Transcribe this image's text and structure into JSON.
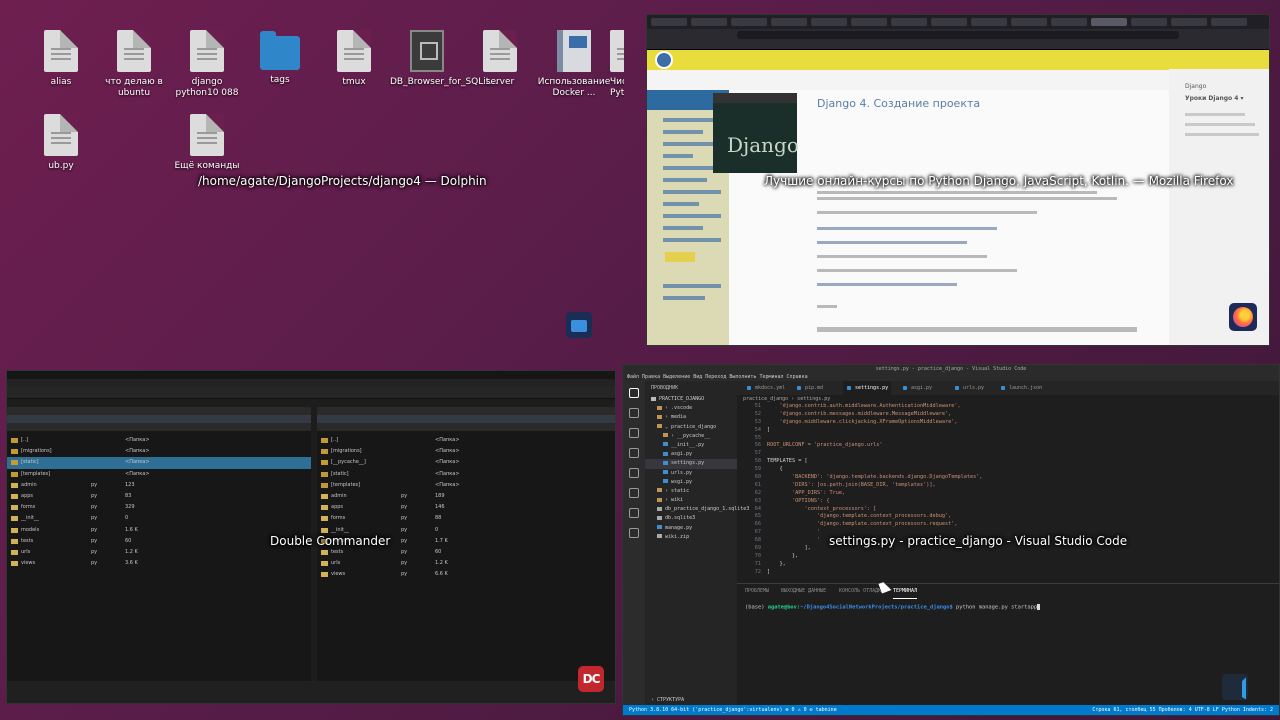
{
  "desktop": {
    "icons": [
      {
        "label": "alias",
        "icon": "file-icon"
      },
      {
        "label": "что делаю в ubuntu",
        "icon": "file-icon"
      },
      {
        "label": "django python10 088",
        "icon": "file-icon"
      },
      {
        "label": "tags",
        "icon": "folder-icon"
      },
      {
        "label": "tmux",
        "icon": "file-icon"
      },
      {
        "label": "DB_Browser_for_SQLit...",
        "icon": "database-icon"
      },
      {
        "label": "server",
        "icon": "file-icon"
      },
      {
        "label": "Использование Docker ...",
        "icon": "book-icon"
      },
      {
        "label": "Чис Pyth",
        "icon": "file-icon"
      },
      {
        "label": "ub.py",
        "icon": "file-icon"
      },
      {
        "label": "Ещё команды",
        "icon": "file-icon"
      }
    ]
  },
  "windows": {
    "dolphin": {
      "caption": "/home/agate/DjangoProjects/django4 — Dolphin"
    },
    "firefox": {
      "caption": "Лучшие онлайн-курсы по Python Django, JavaScript, Kotlin. — Mozilla Firefox",
      "page_title": "Django 4. Создание проекта",
      "django_logo": "Django",
      "toc": [
        "Django",
        "Уроки Django 4 ▾"
      ]
    },
    "double_commander": {
      "caption": "Double Commander",
      "logo": "DC",
      "left_rows": [
        {
          "name": "[..]",
          "ext": "",
          "size": "<Папка>",
          "sel": false
        },
        {
          "name": "[migrations]",
          "ext": "",
          "size": "<Папка>",
          "sel": false
        },
        {
          "name": "[static]",
          "ext": "",
          "size": "<Папка>",
          "sel": true
        },
        {
          "name": "[templates]",
          "ext": "",
          "size": "<Папка>",
          "sel": false
        },
        {
          "name": "admin",
          "ext": "py",
          "size": "123",
          "sel": false
        },
        {
          "name": "apps",
          "ext": "py",
          "size": "83",
          "sel": false
        },
        {
          "name": "forms",
          "ext": "py",
          "size": "329",
          "sel": false
        },
        {
          "name": "__init__",
          "ext": "py",
          "size": "0",
          "sel": false
        },
        {
          "name": "models",
          "ext": "py",
          "size": "1.6 K",
          "sel": false
        },
        {
          "name": "tests",
          "ext": "py",
          "size": "60",
          "sel": false
        },
        {
          "name": "urls",
          "ext": "py",
          "size": "1.2 K",
          "sel": false
        },
        {
          "name": "views",
          "ext": "py",
          "size": "3.6 K",
          "sel": false
        }
      ],
      "right_rows": [
        {
          "name": "[..]",
          "ext": "",
          "size": "<Папка>",
          "sel": false
        },
        {
          "name": "[migrations]",
          "ext": "",
          "size": "<Папка>",
          "sel": false
        },
        {
          "name": "[__pycache__]",
          "ext": "",
          "size": "<Папка>",
          "sel": false
        },
        {
          "name": "[static]",
          "ext": "",
          "size": "<Папка>",
          "sel": false
        },
        {
          "name": "[templates]",
          "ext": "",
          "size": "<Папка>",
          "sel": false
        },
        {
          "name": "admin",
          "ext": "py",
          "size": "189",
          "sel": false
        },
        {
          "name": "apps",
          "ext": "py",
          "size": "146",
          "sel": false
        },
        {
          "name": "forms",
          "ext": "py",
          "size": "88",
          "sel": false
        },
        {
          "name": "__init__",
          "ext": "py",
          "size": "0",
          "sel": false
        },
        {
          "name": "models",
          "ext": "py",
          "size": "1.7 K",
          "sel": false
        },
        {
          "name": "tests",
          "ext": "py",
          "size": "60",
          "sel": false
        },
        {
          "name": "urls",
          "ext": "py",
          "size": "1.2 K",
          "sel": false
        },
        {
          "name": "views",
          "ext": "py",
          "size": "6.6 K",
          "sel": false
        }
      ]
    },
    "vscode": {
      "caption": "settings.py - practice_django - Visual Studio Code",
      "title_bar": "settings.py - practice_django - Visual Studio Code",
      "menu": "Файл  Правка  Выделение  Вид  Переход  Выполнить  Терминал  Справка",
      "explorer_title": "ПРОВОДНИК",
      "files": [
        {
          "name": "PRACTICE_DJANGO",
          "indent": 0,
          "color": "#bbbbbb",
          "sel": false
        },
        {
          "name": "› .vscode",
          "indent": 1,
          "color": "#c09553",
          "sel": false
        },
        {
          "name": "› media",
          "indent": 1,
          "color": "#c09553",
          "sel": false
        },
        {
          "name": "⌄ practice_django",
          "indent": 1,
          "color": "#c09553",
          "sel": false
        },
        {
          "name": "› __pycache__",
          "indent": 2,
          "color": "#c09553",
          "sel": false
        },
        {
          "name": "__init__.py",
          "indent": 2,
          "color": "#3c8fd1",
          "sel": false
        },
        {
          "name": "asgi.py",
          "indent": 2,
          "color": "#3c8fd1",
          "sel": false
        },
        {
          "name": "settings.py",
          "indent": 2,
          "color": "#3c8fd1",
          "sel": true
        },
        {
          "name": "urls.py",
          "indent": 2,
          "color": "#3c8fd1",
          "sel": false
        },
        {
          "name": "wsgi.py",
          "indent": 2,
          "color": "#3c8fd1",
          "sel": false
        },
        {
          "name": "› static",
          "indent": 1,
          "color": "#c09553",
          "sel": false
        },
        {
          "name": "› wiki",
          "indent": 1,
          "color": "#c09553",
          "sel": false
        },
        {
          "name": "db_practice_django_1.sqlite3",
          "indent": 1,
          "color": "#aaaaaa",
          "sel": false
        },
        {
          "name": "db.sqlite3",
          "indent": 1,
          "color": "#aaaaaa",
          "sel": false
        },
        {
          "name": "manage.py",
          "indent": 1,
          "color": "#3c8fd1",
          "sel": false
        },
        {
          "name": "wiki.zip",
          "indent": 1,
          "color": "#aaaaaa",
          "sel": false
        }
      ],
      "outline_label": "› СТРУКТУРА",
      "tabs": [
        "mkdocs.yml",
        "pip.md",
        "settings.py",
        "asgi.py",
        "urls.py",
        "launch.json"
      ],
      "active_tab": 2,
      "breadcrumb": "practice_django › settings.py",
      "code": [
        {
          "n": "51",
          "t": "    'django.contrib.auth.middleware.AuthenticationMiddleware',"
        },
        {
          "n": "52",
          "t": "    'django.contrib.messages.middleware.MessageMiddleware',"
        },
        {
          "n": "53",
          "t": "    'django.middleware.clickjacking.XFrameOptionsMiddleware',"
        },
        {
          "n": "54",
          "t": "]"
        },
        {
          "n": "55",
          "t": ""
        },
        {
          "n": "56",
          "t": "ROOT_URLCONF = 'practice_django.urls'"
        },
        {
          "n": "57",
          "t": ""
        },
        {
          "n": "58",
          "t": "TEMPLATES = ["
        },
        {
          "n": "59",
          "t": "    {"
        },
        {
          "n": "60",
          "t": "        'BACKEND': 'django.template.backends.django.DjangoTemplates',"
        },
        {
          "n": "61",
          "t": "        'DIRS': [os.path.join(BASE_DIR, 'templates')],"
        },
        {
          "n": "62",
          "t": "        'APP_DIRS': True,"
        },
        {
          "n": "63",
          "t": "        'OPTIONS': {"
        },
        {
          "n": "64",
          "t": "            'context_processors': ["
        },
        {
          "n": "65",
          "t": "                'django.template.context_processors.debug',"
        },
        {
          "n": "66",
          "t": "                'django.template.context_processors.request',"
        },
        {
          "n": "67",
          "t": "                '"
        },
        {
          "n": "68",
          "t": "                '"
        },
        {
          "n": "69",
          "t": "            ],"
        },
        {
          "n": "70",
          "t": "        },"
        },
        {
          "n": "71",
          "t": "    },"
        },
        {
          "n": "72",
          "t": "]"
        }
      ],
      "panel_tabs": [
        "ПРОБЛЕМЫ",
        "ВЫХОДНЫЕ ДАННЫЕ",
        "КОНСОЛЬ ОТЛАДКИ",
        "ТЕРМИНАЛ"
      ],
      "active_panel_tab": 3,
      "terminal_env": "(base) ",
      "terminal_prompt": "agate@bov:",
      "terminal_path": "~/Django4SocialNetworkProjects/practice_django$",
      "terminal_command": " python manage.py startapp",
      "status_left": "Python 3.8.10 64-bit ('practice_django':virtualenv)   ⊗ 0 ⚠ 0   ⊙ tabnine",
      "status_right": "Строка 61, столбец 55   Пробелов: 4   UTF-8   LF   Python   Indents: 2"
    }
  }
}
